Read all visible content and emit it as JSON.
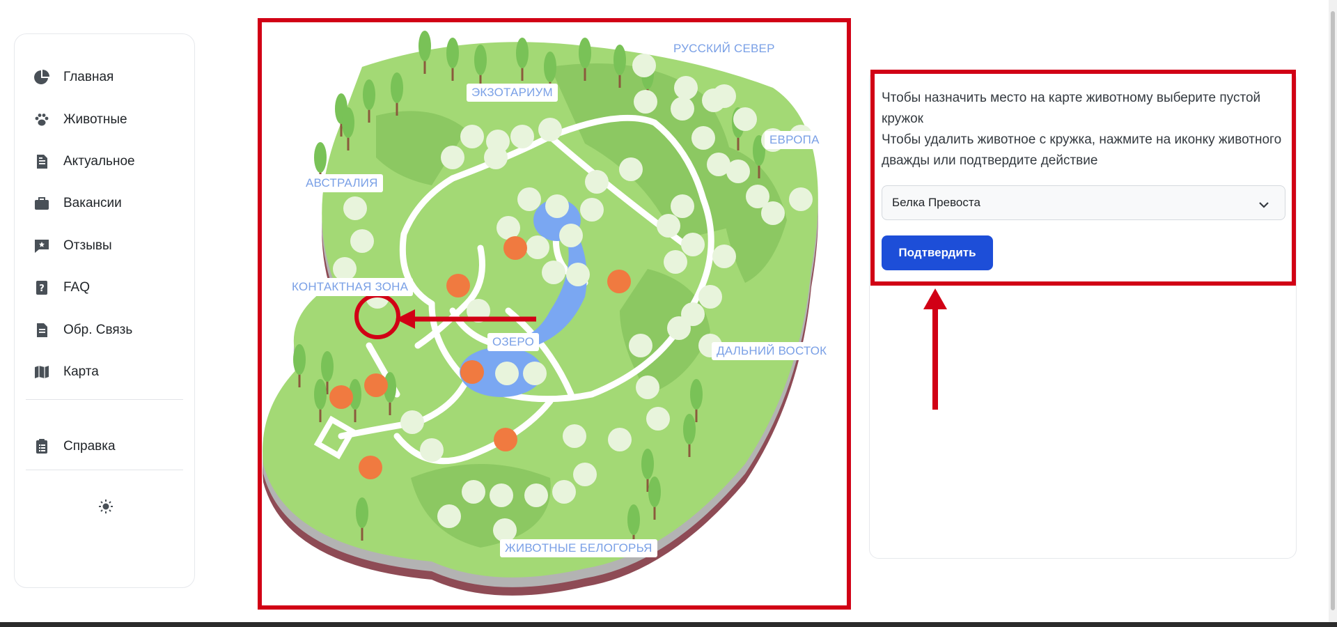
{
  "sidebar": {
    "items": [
      {
        "label": "Главная",
        "icon": "pie-chart-icon"
      },
      {
        "label": "Животные",
        "icon": "paw-icon"
      },
      {
        "label": "Актуальное",
        "icon": "document-icon"
      },
      {
        "label": "Вакансии",
        "icon": "briefcase-icon"
      },
      {
        "label": "Отзывы",
        "icon": "review-icon"
      },
      {
        "label": "FAQ",
        "icon": "question-icon"
      },
      {
        "label": "Обр. Связь",
        "icon": "feedback-icon"
      },
      {
        "label": "Карта",
        "icon": "map-icon"
      }
    ],
    "help_label": "Справка",
    "theme_icon": "sun-icon"
  },
  "map": {
    "zones": {
      "north": "РУССКИЙ СЕВЕР",
      "exotarium": "ЭКЗОТАРИУМ",
      "europe": "ЕВРОПА",
      "australia": "АВСТРАЛИЯ",
      "contact": "КОНТАКТНАЯ ЗОНА",
      "lake": "ОЗЕРО",
      "far_east": "ДАЛЬНИЙ ВОСТОК",
      "belogorye": "ЖИВОТНЫЕ БЕЛОГОРЬЯ"
    },
    "colors": {
      "land": "#a3d975",
      "path": "#ffffff",
      "water": "#7aa7f2",
      "facility": "#f07a40",
      "highlight": "#d10015"
    }
  },
  "panel": {
    "instruction_1": "Чтобы назначить место на карте животному выберите пустой кружок",
    "instruction_2": "Чтобы удалить животное с кружка, нажмите на иконку животного дважды или подтвердите действие",
    "select_value": "Белка Превоста",
    "confirm_label": "Подтвердить"
  }
}
